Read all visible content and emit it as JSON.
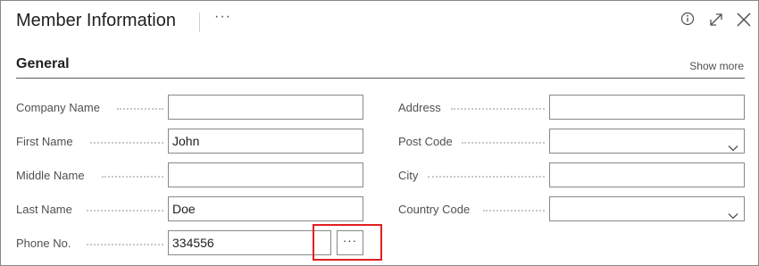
{
  "header": {
    "title": "Member Information",
    "more_label": "···"
  },
  "section": {
    "title": "General",
    "show_more": "Show more"
  },
  "left_fields": [
    {
      "label": "Company Name",
      "value": ""
    },
    {
      "label": "First Name",
      "value": "John"
    },
    {
      "label": "Middle Name",
      "value": ""
    },
    {
      "label": "Last Name",
      "value": "Doe"
    },
    {
      "label": "Phone No.",
      "value": "334556"
    }
  ],
  "right_fields": [
    {
      "label": "Address",
      "value": ""
    },
    {
      "label": "Post Code",
      "value": ""
    },
    {
      "label": "City",
      "value": ""
    },
    {
      "label": "Country Code",
      "value": ""
    }
  ],
  "lookup_button_label": "···",
  "colors": {
    "highlight": "#e02020",
    "border": "#8a8886",
    "label": "#505050"
  }
}
